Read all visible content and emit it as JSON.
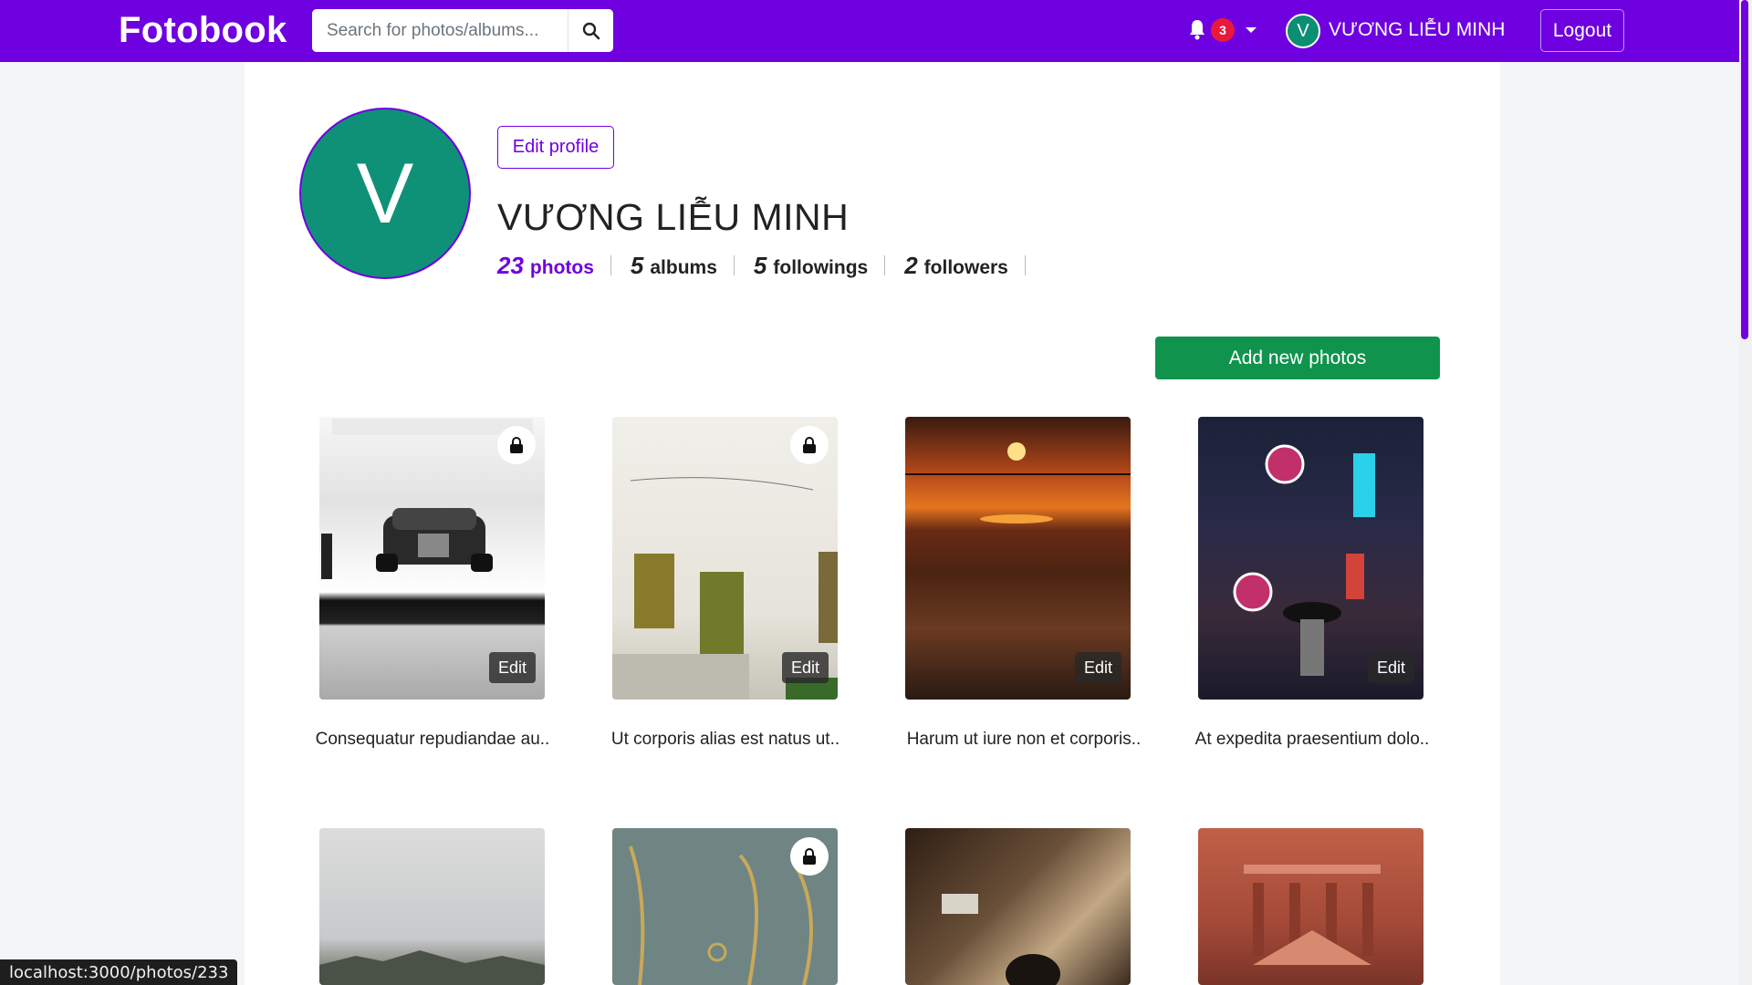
{
  "navbar": {
    "brand": "Fotobook",
    "search_placeholder": "Search for photos/albums...",
    "notification_count": "3",
    "user_initial": "V",
    "user_name": "VƯƠNG LIỄU MINH",
    "logout_label": "Logout"
  },
  "profile": {
    "avatar_initial": "V",
    "edit_label": "Edit profile",
    "name": "VƯƠNG LIỄU MINH",
    "stats": [
      {
        "num": "23",
        "label": "photos"
      },
      {
        "num": "5",
        "label": "albums"
      },
      {
        "num": "5",
        "label": "followings"
      },
      {
        "num": "2",
        "label": "followers"
      }
    ]
  },
  "actions": {
    "add_photos_label": "Add new photos"
  },
  "photos": [
    {
      "caption": "Consequatur repudiandae au..",
      "edit_label": "Edit",
      "locked": true
    },
    {
      "caption": "Ut corporis alias est natus ut..",
      "edit_label": "Edit",
      "locked": true
    },
    {
      "caption": "Harum ut iure non et corporis..",
      "edit_label": "Edit",
      "locked": false
    },
    {
      "caption": "At expedita praesentium dolo..",
      "edit_label": "Edit",
      "locked": false
    },
    {
      "caption": "",
      "edit_label": "",
      "locked": false
    },
    {
      "caption": "",
      "edit_label": "",
      "locked": true
    },
    {
      "caption": "",
      "edit_label": "",
      "locked": false
    },
    {
      "caption": "",
      "edit_label": "",
      "locked": false
    }
  ],
  "status_bar": {
    "url": "localhost:3000/photos/233"
  },
  "colors": {
    "primary": "#6f00e0",
    "success": "#10944d",
    "avatar": "#0f9177",
    "badge": "#e8193c"
  }
}
